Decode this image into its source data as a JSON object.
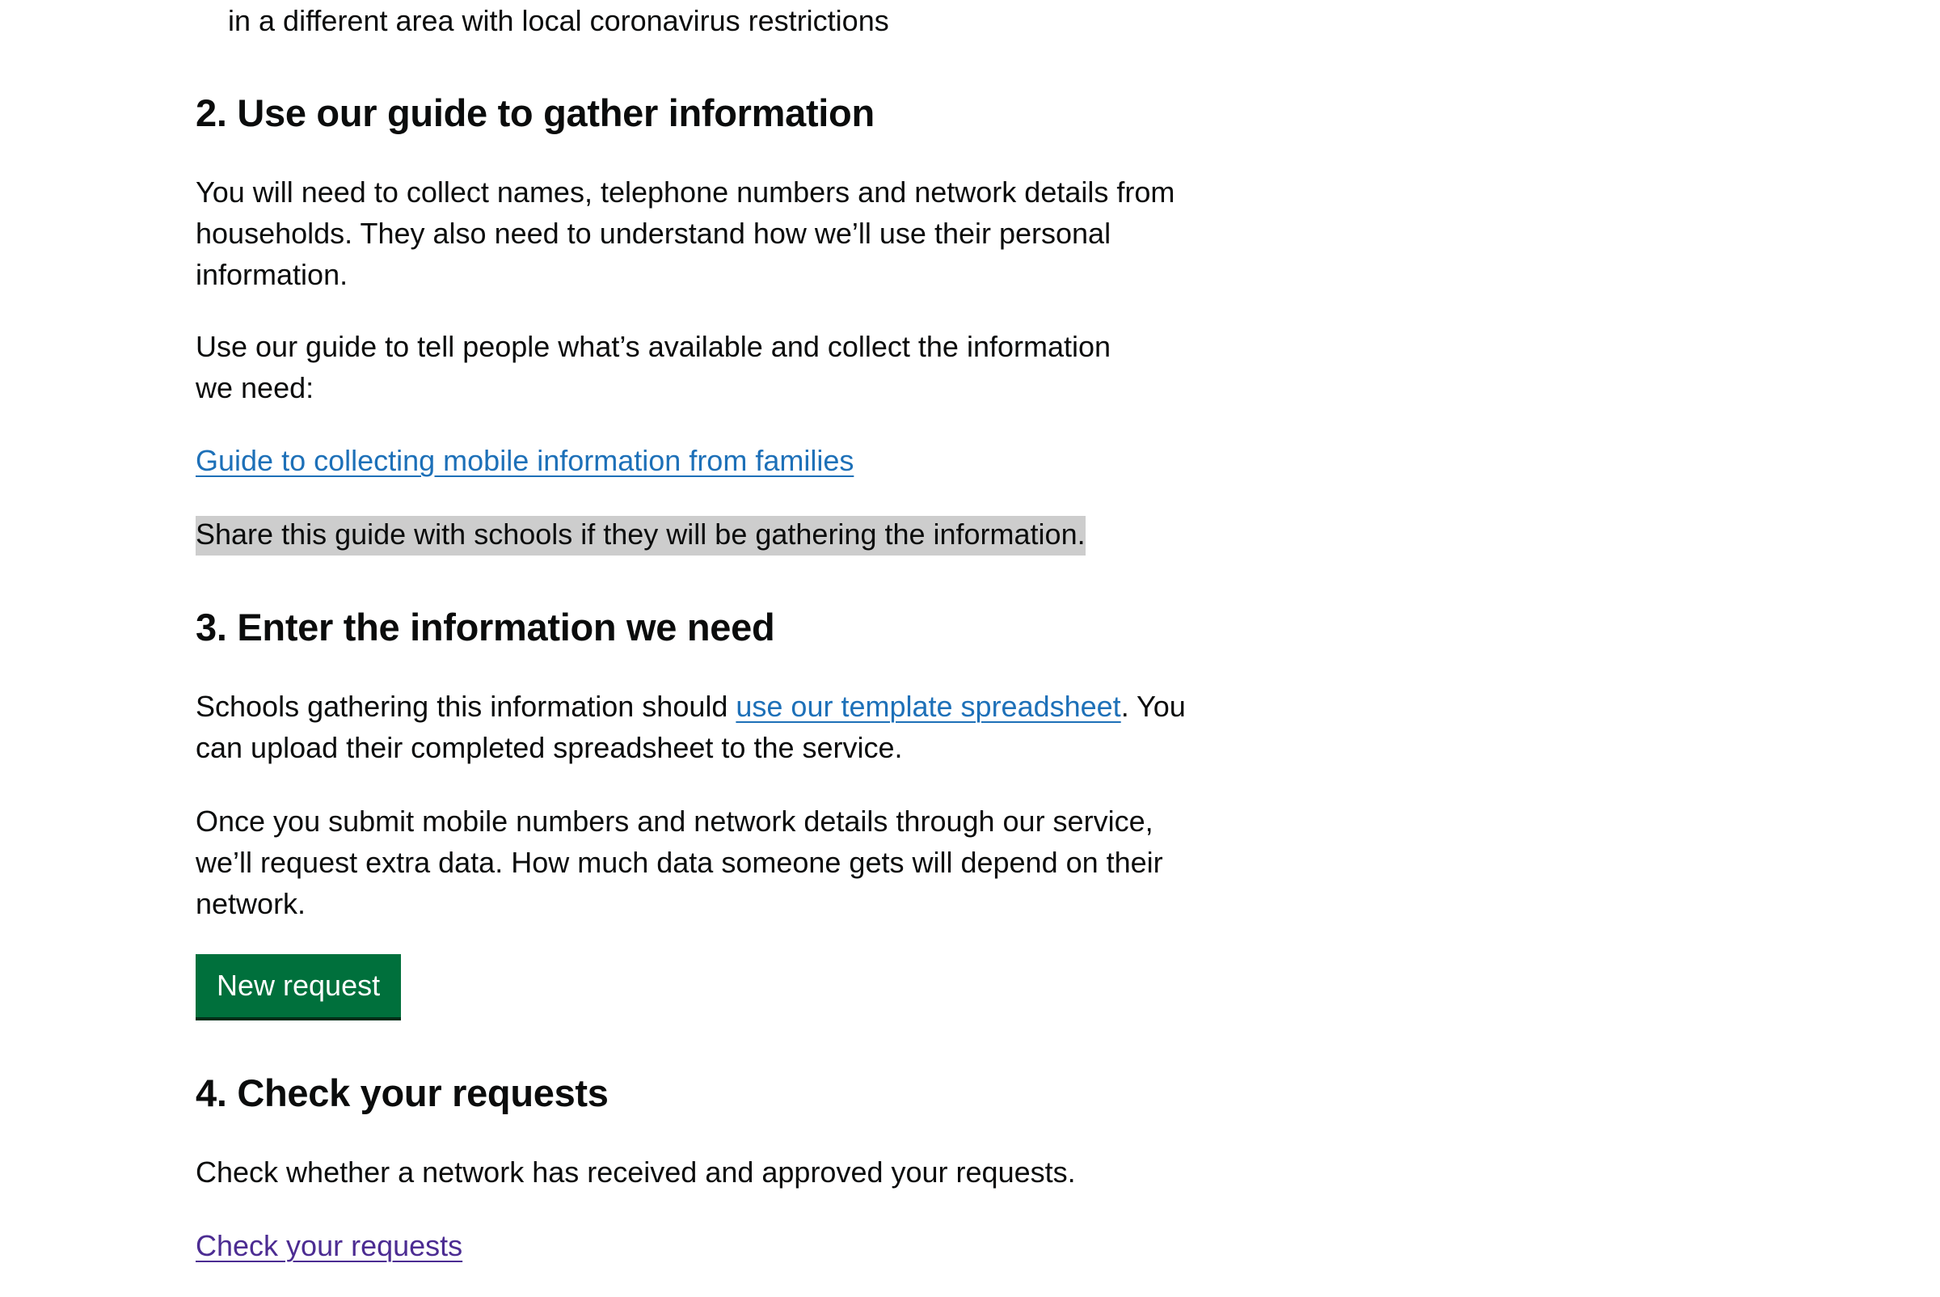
{
  "intro": {
    "list_tail": "in a different area with local coronavirus restrictions"
  },
  "step2": {
    "heading": "2. Use our guide to gather information",
    "para1_line1": "You will need to collect names, telephone numbers and network details from",
    "para1_line2": "households. They also need to understand how we’ll use their personal",
    "para1_line3": "information.",
    "para2_line1": "Use our guide to tell people what’s available and collect the information",
    "para2_line2": "we need:",
    "guide_link": "Guide to collecting mobile information from families",
    "share_note": "Share this guide with schools if they will be gathering the information."
  },
  "step3": {
    "heading": "3. Enter the information we need",
    "para1_before": "Schools gathering this information should ",
    "template_link": "use our template spreadsheet",
    "para1_after": ". You",
    "para1_line2": "can upload their completed spreadsheet to the service.",
    "para2_line1": "Once you submit mobile numbers and network details through our service,",
    "para2_line2": "we’ll request extra data. How much data someone gets will depend on their",
    "para2_line3": "network.",
    "new_request_button": "New request"
  },
  "step4": {
    "heading": "4. Check your requests",
    "para": "Check whether a network has received and approved your requests.",
    "check_link": "Check your requests"
  },
  "colors": {
    "text": "#0b0c0c",
    "link": "#1d70b8",
    "visited_link": "#4c2c92",
    "button": "#00703c",
    "highlight": "#cdcdcd"
  }
}
